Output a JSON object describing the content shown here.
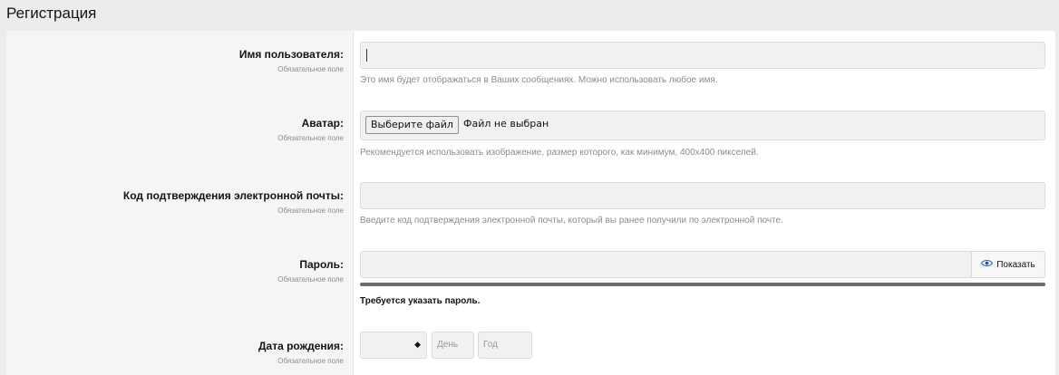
{
  "page": {
    "title": "Регистрация"
  },
  "form": {
    "username": {
      "label": "Имя пользователя:",
      "required": "Обязательное поле",
      "value": "",
      "hint": "Это имя будет отображаться в Ваших сообщениях. Можно использовать любое имя."
    },
    "avatar": {
      "label": "Аватар:",
      "required": "Обязательное поле",
      "button": "Выберите файл",
      "status": "Файл не выбран",
      "hint": "Рекомендуется использовать изображение, размер которого, как минимум, 400x400 пикселей."
    },
    "email_code": {
      "label": "Код подтверждения электронной почты:",
      "required": "Обязательное поле",
      "value": "",
      "hint": "Введите код подтверждения электронной почты, который вы ранее получили по электронной почте."
    },
    "password": {
      "label": "Пароль:",
      "required": "Обязательное поле",
      "value": "",
      "show_label": "Показать",
      "show_icon": "eye-icon",
      "message": "Требуется указать пароль."
    },
    "birthdate": {
      "label": "Дата рождения:",
      "required": "Обязательное поле",
      "month_value": "",
      "day_placeholder": "День",
      "year_placeholder": "Год"
    }
  },
  "colors": {
    "background": "#ececec",
    "label_column": "#f5f5f5",
    "input_bg": "#f1f1f1",
    "hint_text": "#8c8c8c",
    "strength_bar": "#6b6b6b"
  }
}
